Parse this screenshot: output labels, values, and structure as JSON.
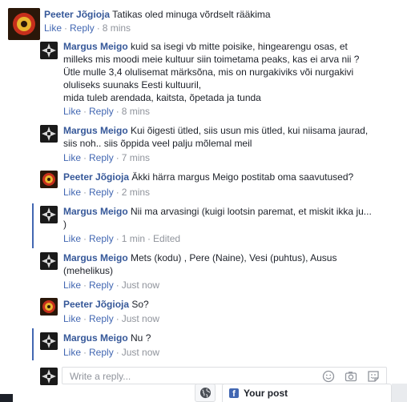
{
  "actions": {
    "like": "Like",
    "reply": "Reply",
    "edited": "Edited"
  },
  "comments": [
    {
      "author": "Peeter Jõgioja",
      "text": "Tatikas oled minuga võrdselt rääkima",
      "time": "8 mins"
    },
    {
      "author": "Margus Meigo",
      "lines": [
        "kuid sa isegi vb mitte poisike, hingearengu osas, et",
        "milleks mis moodi meie kultuur siin toimetama peaks, kas ei arva nii ?",
        "Ütle mulle 3,4 olulisemat märksõna, mis on nurgakiviks või nurgakivi",
        "oluliseks suunaks Eesti kultuuril,",
        "mida tuleb arendada, kaitsta, õpetada ja tunda"
      ],
      "time": "8 mins"
    },
    {
      "author": "Margus Meigo",
      "lines": [
        "Kui õigesti ütled, siis usun mis ütled, kui niisama jaurad,",
        "siis noh.. siis õppida veel palju mõlemal meil"
      ],
      "time": "7 mins"
    },
    {
      "author": "Peeter Jõgioja",
      "text": "Äkki härra margus Meigo postitab oma saavutused?",
      "time": "2 mins"
    },
    {
      "author": "Margus Meigo",
      "lines": [
        "Nii ma arvasingi (kuigi lootsin paremat, et miskit ikka ju...",
        ")"
      ],
      "time": "1 min"
    },
    {
      "author": "Margus Meigo",
      "lines": [
        "Mets (kodu) , Pere (Naine), Vesi (puhtus), Ausus",
        "(mehelikus)"
      ],
      "time": "Just now"
    },
    {
      "author": "Peeter Jõgioja",
      "text": "So?",
      "time": "Just now"
    },
    {
      "author": "Margus Meigo",
      "text": "Nu ?",
      "time": "Just now"
    }
  ],
  "reply_box": {
    "placeholder": "Write a reply..."
  },
  "footer": {
    "your_post": "Your post"
  },
  "icons": {
    "emoji": "smiley-icon",
    "camera": "camera-icon",
    "sticker": "sticker-icon",
    "globe": "globe-icon",
    "facebook": "facebook-icon"
  },
  "colors": {
    "author": "#365899",
    "link": "#4267b2",
    "meta": "#90949c",
    "text": "#1d2129"
  }
}
